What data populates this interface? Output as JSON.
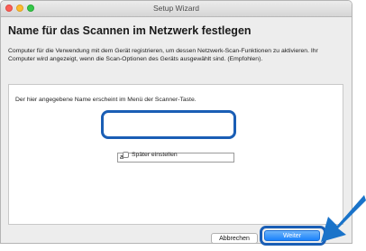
{
  "window": {
    "title": "Setup Wizard"
  },
  "heading": "Name für das Scannen im Netzwerk festlegen",
  "description": "Computer für die Verwendung mit dem Gerät registrieren, um dessen Netzwerk-Scan-Funktionen zu aktivieren. Ihr Computer wird angezeigt, wenn die Scan-Optionen des Geräts ausgewählt sind. (Empfohlen).",
  "panel": {
    "hint": "Der hier angegebene Name erscheint im Menü der Scanner-Taste.",
    "name_value": "a",
    "later_label": "Später einstellen",
    "later_checked": false
  },
  "buttons": {
    "cancel": "Abbrechen",
    "next": "Weiter"
  },
  "colors": {
    "highlight": "#1a5eb5",
    "accent": "#1a82fb"
  }
}
